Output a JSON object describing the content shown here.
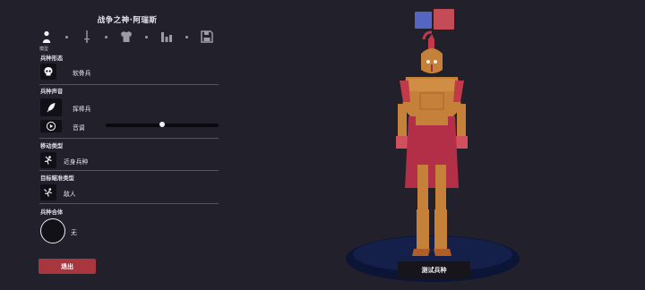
{
  "unit_title": "战争之神·阿瑞斯",
  "tabs": {
    "active_caption": "模型",
    "items": [
      {
        "icon": "person-icon"
      },
      {
        "icon": "sword-icon"
      },
      {
        "icon": "armor-shirt-icon"
      },
      {
        "icon": "stats-bars-icon"
      },
      {
        "icon": "save-icon"
      }
    ]
  },
  "sections": {
    "form": {
      "label": "兵种形态",
      "value": "软骨兵",
      "icon": "skull-icon"
    },
    "voice": {
      "label": "兵种声音",
      "value": "挥棒兵",
      "icon": "feather-icon",
      "pitch_label": "音调",
      "pitch_icon": "play-circle-icon",
      "pitch_level": 0.5
    },
    "movement": {
      "label": "移动类型",
      "value": "近身兵种",
      "icon": "melee-icon"
    },
    "targeting": {
      "label": "目标瞄准类型",
      "value": "敌人",
      "icon": "target-enemy-icon"
    },
    "combined": {
      "label": "兵种合体",
      "value": "无"
    }
  },
  "buttons": {
    "exit": "退出",
    "test_unit": "测试兵种"
  },
  "team_colors": {
    "blue": "#5466c2",
    "red": "#c44c56"
  }
}
